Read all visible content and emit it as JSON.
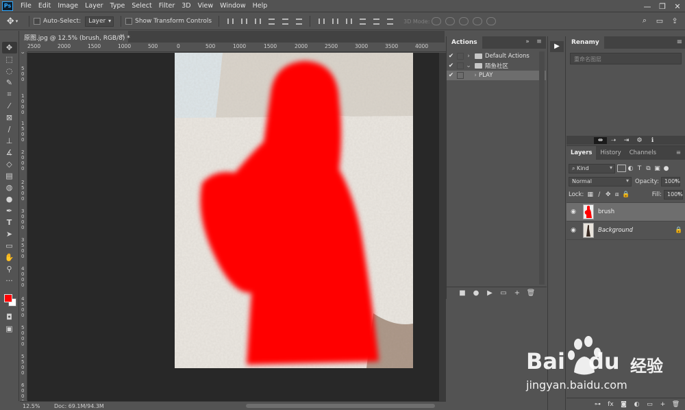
{
  "app": {
    "logo_text": "Ps",
    "menu": [
      "File",
      "Edit",
      "Image",
      "Layer",
      "Type",
      "Select",
      "Filter",
      "3D",
      "View",
      "Window",
      "Help"
    ]
  },
  "window_controls": [
    "—",
    "❐",
    "✕"
  ],
  "options_bar": {
    "auto_select_label": "Auto-Select:",
    "auto_select_value": "Layer",
    "transform_controls_label": "Show Transform Controls",
    "mode_3d_label": "3D Mode:"
  },
  "document": {
    "tab_title": "原图.jpg @ 12.5% (brush, RGB/8) *",
    "close": "×",
    "zoom": "12.5%",
    "doc_size": "Doc: 69.1M/94.3M",
    "h_ruler_labels": [
      "2500",
      "2000",
      "1500",
      "1000",
      "500",
      "0",
      "500",
      "1000",
      "1500",
      "2000",
      "2500",
      "3000",
      "3500",
      "4000"
    ],
    "v_ruler_labels": [
      "0",
      "500",
      "1000",
      "1500",
      "2000",
      "2500",
      "3000",
      "3500",
      "4000",
      "4500",
      "5000",
      "5500",
      "6000"
    ]
  },
  "tools": [
    "move-tool",
    "marquee-tool",
    "lasso-tool",
    "quick-select-tool",
    "crop-tool",
    "eyedropper-tool",
    "frame-tool",
    "brush-tool",
    "stamp-tool",
    "history-brush-tool",
    "eraser-tool",
    "gradient-tool",
    "blur-tool",
    "dodge-tool",
    "pen-tool",
    "type-tool",
    "path-select-tool",
    "rectangle-tool",
    "hand-tool",
    "zoom-tool",
    "more-tools"
  ],
  "colors": {
    "foreground": "#ff0000",
    "background": "#ffffff",
    "panel": "#535353",
    "canvas_bg": "#282828"
  },
  "actions_panel": {
    "title": "Actions",
    "rows": [
      {
        "checked": "✔",
        "expand": "›",
        "label": "Default Actions",
        "type": "set"
      },
      {
        "checked": "✔",
        "expand": "⌄",
        "label": "陌鱼社区",
        "type": "set"
      },
      {
        "checked": "✔",
        "expand": "›",
        "label": "PLAY",
        "type": "action"
      }
    ],
    "footer_buttons": [
      "■",
      "●",
      "▶",
      "▭",
      "+",
      "🗑"
    ]
  },
  "rename_panel": {
    "title": "Renamy",
    "input_placeholder": "重命名图层"
  },
  "layers_panel": {
    "tabs": [
      "Layers",
      "History",
      "Channels"
    ],
    "filter_kind": "Kind",
    "blend_mode": "Normal",
    "opacity_label": "Opacity:",
    "opacity_value": "100%",
    "lock_label": "Lock:",
    "fill_label": "Fill:",
    "fill_value": "100%",
    "layers": [
      {
        "name": "brush",
        "selected": true,
        "locked": false
      },
      {
        "name": "Background",
        "selected": false,
        "locked": true
      }
    ]
  },
  "watermark": {
    "brand": "Bai",
    "brand2": "du",
    "suffix": "经验",
    "url": "jingyan.baidu.com"
  }
}
